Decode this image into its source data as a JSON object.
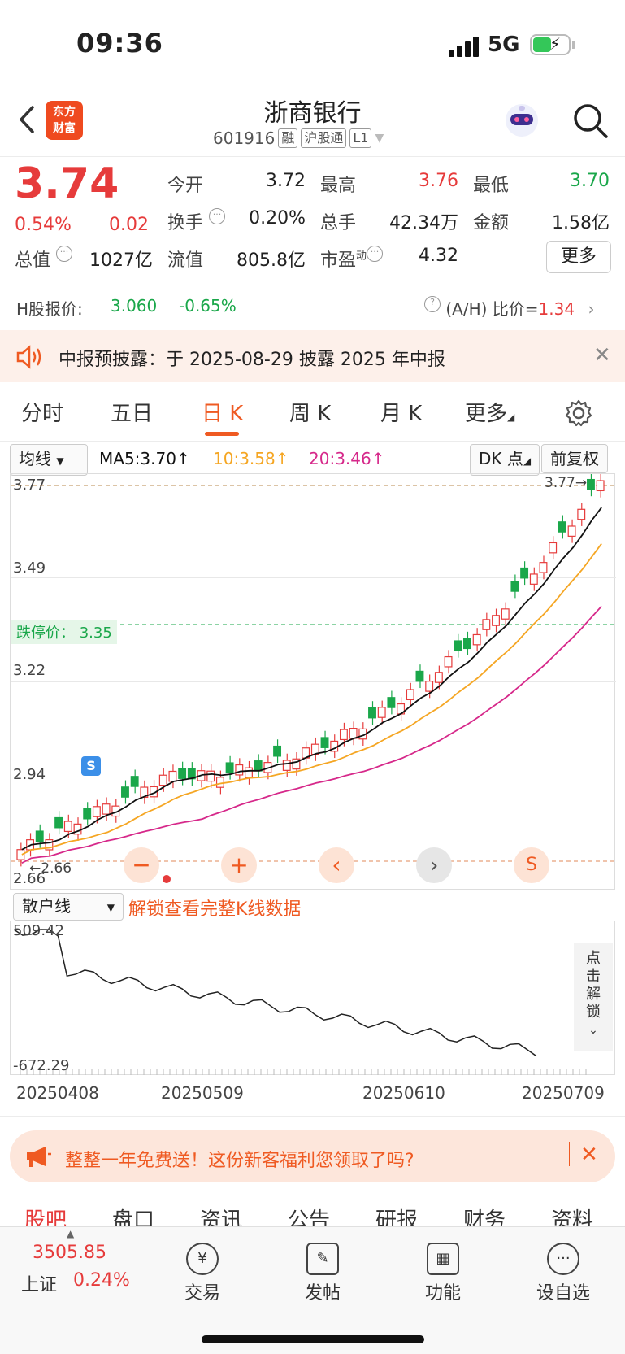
{
  "status": {
    "time": "09:36",
    "network": "5G"
  },
  "header": {
    "logo_line1": "东方",
    "logo_line2": "财富",
    "title": "浙商银行",
    "code": "601916",
    "tags": [
      "融",
      "沪股通",
      "L1"
    ]
  },
  "quote": {
    "price": "3.74",
    "pct": "0.54%",
    "chg": "0.02",
    "fields": [
      {
        "label": "今开",
        "value": "3.72",
        "color": "#222222"
      },
      {
        "label": "最高",
        "value": "3.76",
        "color": "#e63b3b"
      },
      {
        "label": "最低",
        "value": "3.70",
        "color": "#1aa74a"
      },
      {
        "label": "换手",
        "value": "0.20%",
        "color": "#222222"
      },
      {
        "label": "总手",
        "value": "42.34万",
        "color": "#222222"
      },
      {
        "label": "金额",
        "value": "1.58亿",
        "color": "#222222"
      },
      {
        "label": "总值",
        "value": "1027亿",
        "color": "#222222"
      },
      {
        "label": "流值",
        "value": "805.8亿",
        "color": "#222222"
      },
      {
        "label": "市盈",
        "value": "4.32",
        "color": "#222222"
      }
    ],
    "pe_sup": "动",
    "more": "更多"
  },
  "hk": {
    "label": "H股报价:",
    "price": "3.060",
    "chg": "-0.65%",
    "ah_label": "(A/H) 比价=",
    "ah_value": "1.34"
  },
  "notice": {
    "text": "中报预披露：于 2025-08-29 披露 2025 年中报"
  },
  "tabs": [
    "分时",
    "五日",
    "日 K",
    "周 K",
    "月 K",
    "更多"
  ],
  "chart_controls": {
    "indicator": "均线",
    "ma5": "MA5:3.70↑",
    "ma10": "10:3.58↑",
    "ma20": "20:3.46↑",
    "dk": "DK 点",
    "adjust": "前复权"
  },
  "chart_data": {
    "type": "candlestick",
    "y_ticks": [
      "3.77",
      "3.49",
      "3.22",
      "2.94",
      "2.66"
    ],
    "ylim": [
      2.66,
      3.77
    ],
    "limit_down_label": "跌停价：",
    "limit_down_value": "3.35",
    "max_label": "3.77",
    "min_label": "2.66",
    "colors": {
      "up": "#e63b3b",
      "down": "#1aa74a",
      "ma5": "#111111",
      "ma10": "#f5a623",
      "ma20": "#d6288a"
    }
  },
  "lower_chart": {
    "indicator": "散户线",
    "unlock_text": "解锁查看完整K线数据",
    "y_top": "509.42",
    "y_bottom": "-672.29",
    "side_unlock": [
      "点",
      "击",
      "解",
      "锁"
    ]
  },
  "x_labels": [
    "20250408",
    "20250509",
    "20250610",
    "20250709"
  ],
  "promo": {
    "text": "整整一年免费送！这份新客福利您领取了吗?"
  },
  "sub_tabs": [
    "股吧",
    "盘口",
    "资讯",
    "公告",
    "研报",
    "财务",
    "资料"
  ],
  "bottom": {
    "index_value": "3505.85",
    "index_name": "上证",
    "index_pct": "0.24%",
    "items": [
      "交易",
      "发帖",
      "功能",
      "设自选"
    ]
  }
}
